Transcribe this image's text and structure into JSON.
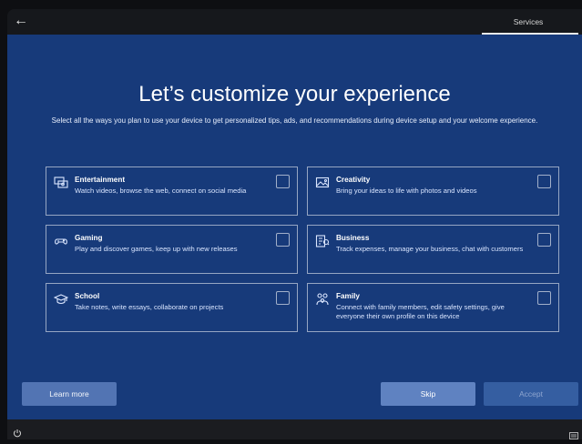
{
  "header": {
    "back_icon": "back-arrow-icon",
    "tab_label": "Services"
  },
  "main": {
    "title": "Let’s customize your experience",
    "subtitle": "Select all the ways you plan to use your device to get personalized tips, ads, and recommendations during device setup and your welcome experience."
  },
  "cards": [
    {
      "name": "Entertainment",
      "desc": "Watch videos, browse the web, connect on social media",
      "icon": "entertainment-icon"
    },
    {
      "name": "Creativity",
      "desc": "Bring your ideas to life with photos and videos",
      "icon": "creativity-icon"
    },
    {
      "name": "Gaming",
      "desc": "Play and discover games, keep up with new releases",
      "icon": "gaming-icon"
    },
    {
      "name": "Business",
      "desc": "Track expenses, manage your business, chat with customers",
      "icon": "business-icon"
    },
    {
      "name": "School",
      "desc": "Take notes, write essays, collaborate on projects",
      "icon": "school-icon"
    },
    {
      "name": "Family",
      "desc": "Connect with family members, edit safety settings, give everyone their own profile on this device",
      "icon": "family-icon"
    }
  ],
  "buttons": {
    "learn_more": "Learn more",
    "skip": "Skip",
    "accept": "Accept"
  },
  "footer": {
    "power_icon": "power-icon",
    "keyboard_icon": "keyboard-icon"
  },
  "colors": {
    "main_bg": "#173a7a",
    "accent": "#5f82c1"
  }
}
